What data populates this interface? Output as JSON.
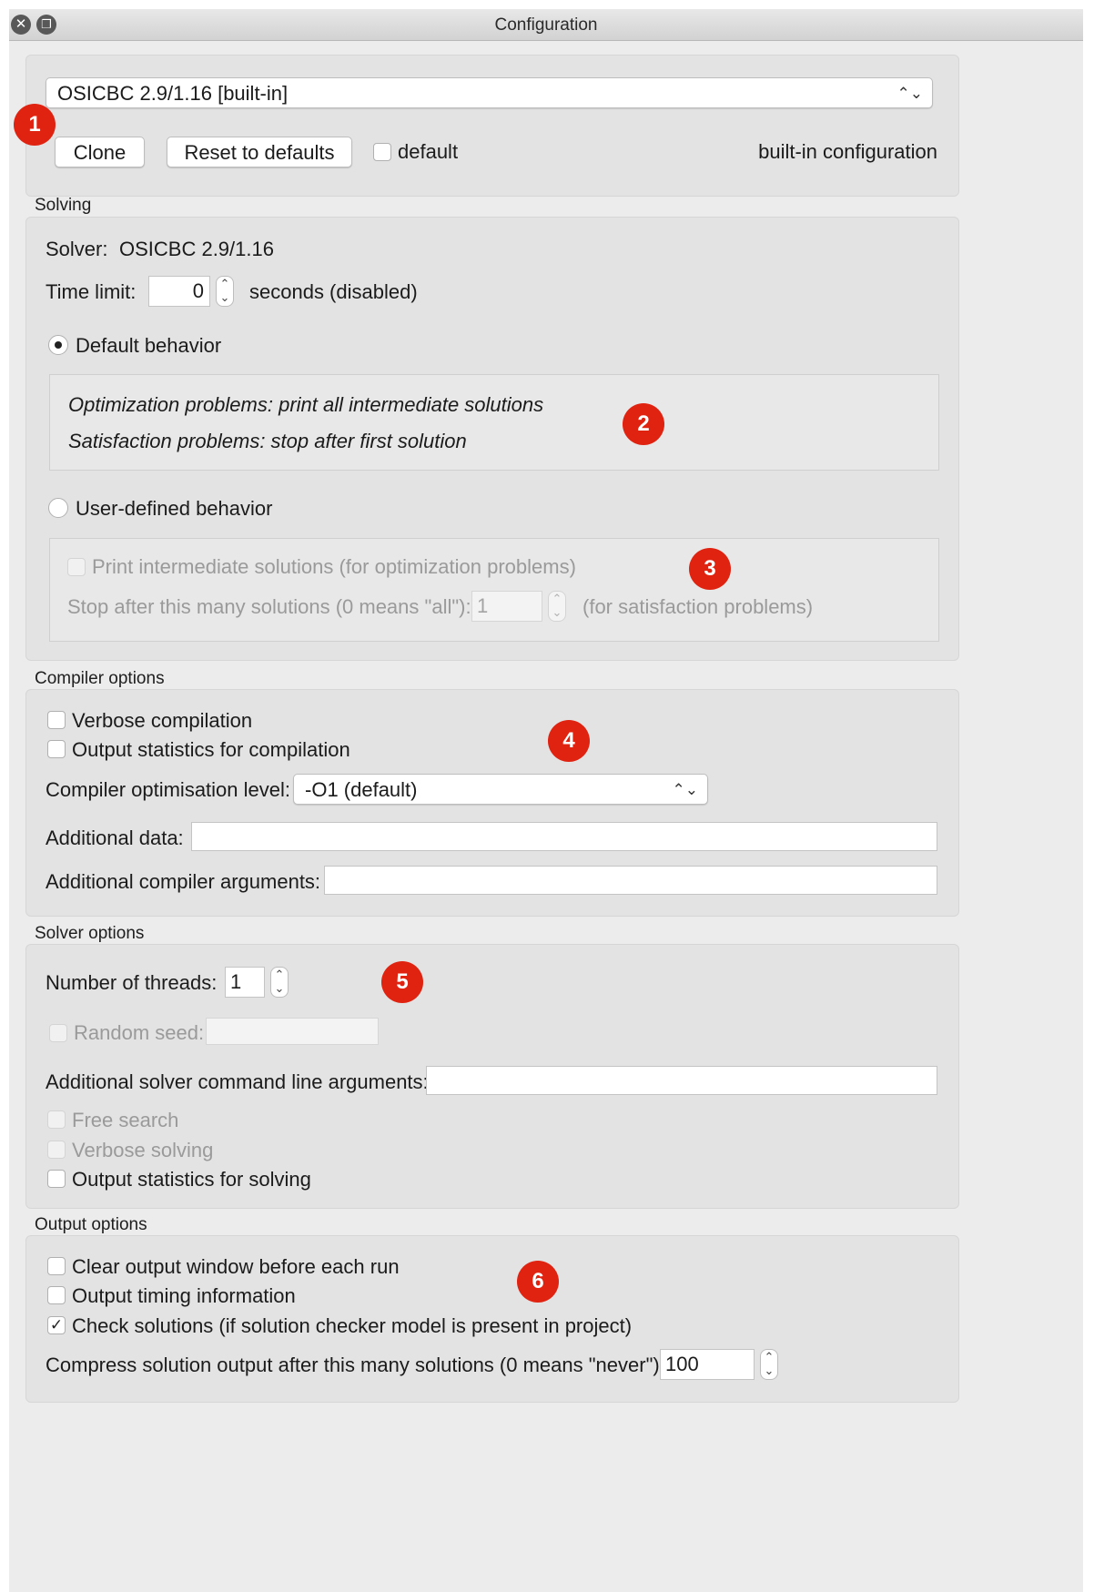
{
  "window": {
    "title": "Configuration"
  },
  "config": {
    "selected": "OSICBC 2.9/1.16 [built-in]",
    "clone_label": "Clone",
    "reset_label": "Reset to defaults",
    "default_label": "default",
    "default_checked": false,
    "info": "built-in configuration"
  },
  "solving": {
    "title": "Solving",
    "solver_label": "Solver:",
    "solver_value": "OSICBC 2.9/1.16",
    "time_limit_label": "Time limit:",
    "time_limit_value": "0",
    "time_limit_suffix": "seconds (disabled)",
    "default_behavior_label": "Default behavior",
    "default_behavior_selected": true,
    "default_line1": "Optimization problems: print all intermediate solutions",
    "default_line2": "Satisfaction problems: stop after first solution",
    "user_behavior_label": "User-defined behavior",
    "print_intermediate_label": "Print intermediate solutions (for optimization problems)",
    "stop_after_label": "Stop after this many solutions (0 means \"all\"):",
    "stop_after_value": "1",
    "stop_after_suffix": "(for satisfaction problems)"
  },
  "compiler": {
    "title": "Compiler options",
    "verbose_label": "Verbose compilation",
    "stats_label": "Output statistics for compilation",
    "opt_level_label": "Compiler optimisation level:",
    "opt_level_value": "-O1 (default)",
    "additional_data_label": "Additional data:",
    "additional_data_value": "",
    "additional_args_label": "Additional compiler arguments:",
    "additional_args_value": ""
  },
  "solver_options": {
    "title": "Solver options",
    "threads_label": "Number of threads:",
    "threads_value": "1",
    "random_seed_label": "Random seed:",
    "random_seed_value": "",
    "cmd_args_label": "Additional solver command line arguments:",
    "cmd_args_value": "",
    "free_search_label": "Free search",
    "verbose_solving_label": "Verbose solving",
    "stats_solving_label": "Output statistics for solving"
  },
  "output": {
    "title": "Output options",
    "clear_label": "Clear output window before each run",
    "timing_label": "Output timing information",
    "check_label": "Check solutions (if solution checker model is present in project)",
    "check_checked": true,
    "compress_label": "Compress solution output after this many solutions (0 means \"never\"):",
    "compress_value": "100"
  },
  "icons": {
    "close": "close-icon",
    "restore": "restore-icon",
    "combo_arrow": "chevron-updown-icon",
    "check": "check-icon"
  },
  "annotations": [
    "1",
    "2",
    "3",
    "4",
    "5",
    "6"
  ],
  "colors": {
    "badge": "#e02211",
    "window_bg": "#ececec",
    "panel_bg": "#e3e3e3"
  }
}
